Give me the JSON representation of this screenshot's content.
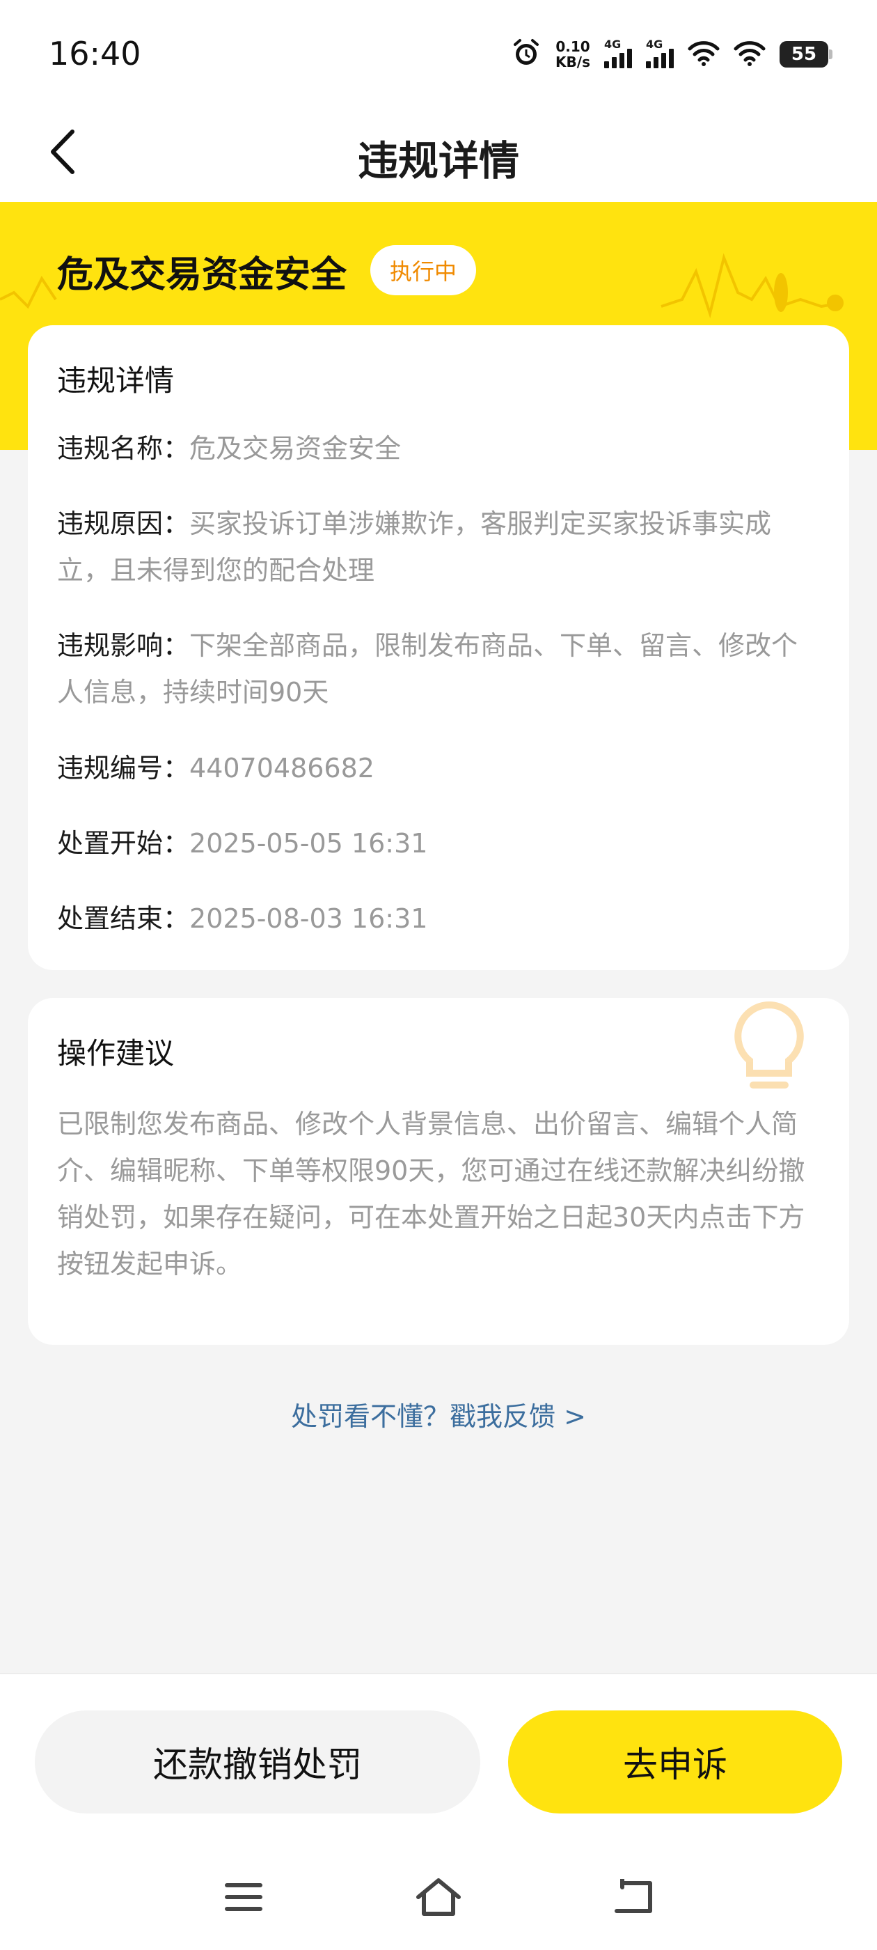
{
  "status_bar": {
    "time": "16:40",
    "net_speed_value": "0.10",
    "net_speed_unit": "KB/s",
    "sim1_label": "4G",
    "sim2_label": "4G",
    "battery": "55",
    "icons": [
      "alarm-icon",
      "signal-icon",
      "wifi-icon",
      "battery-icon"
    ]
  },
  "header": {
    "title": "违规详情",
    "back_icon": "chevron-left-icon"
  },
  "banner": {
    "violation_title": "危及交易资金安全",
    "status": "执行中",
    "status_color": "#f08a00",
    "accent_color": "#ffe30f"
  },
  "details_card": {
    "title": "违规详情",
    "rows": [
      {
        "key": "违规名称：",
        "value": "危及交易资金安全"
      },
      {
        "key": "违规原因：",
        "value": "买家投诉订单涉嫌欺诈，客服判定买家投诉事实成立，且未得到您的配合处理"
      },
      {
        "key": "违规影响：",
        "value": "下架全部商品，限制发布商品、下单、留言、修改个人信息，持续时间90天"
      },
      {
        "key": "违规编号：",
        "value": "44070486682"
      },
      {
        "key": "处置开始：",
        "value": "2025-05-05 16:31"
      },
      {
        "key": "处置结束：",
        "value": "2025-08-03 16:31"
      }
    ]
  },
  "advice_card": {
    "title": "操作建议",
    "text": "已限制您发布商品、修改个人背景信息、出价留言、编辑个人简介、编辑昵称、下单等权限90天，您可通过在线还款解决纠纷撤销处罚，如果存在疑问，可在本处置开始之日起30天内点击下方按钮发起申诉。"
  },
  "feedback_link": "处罚看不懂？戳我反馈 >",
  "actions": {
    "refund_label": "还款撤销处罚",
    "appeal_label": "去申诉"
  },
  "system_nav": [
    "menu-icon",
    "home-icon",
    "back-icon"
  ]
}
